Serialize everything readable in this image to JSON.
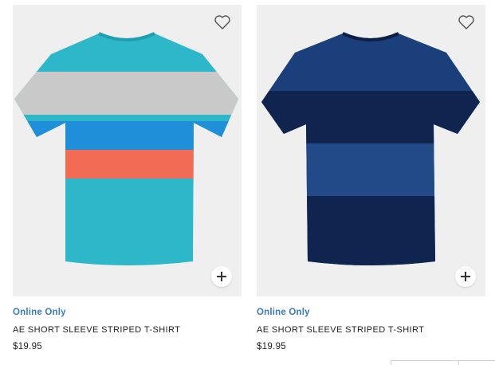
{
  "products": [
    {
      "badge": "Online Only",
      "name": "AE SHORT SLEEVE STRIPED T-SHIRT",
      "price": "$19.95",
      "colors": {
        "base": "#2db7c9",
        "stripe_gray": "#c9c9c9",
        "stripe_blue": "#1e8fd8",
        "stripe_coral": "#f26b55"
      }
    },
    {
      "badge": "Online Only",
      "name": "AE SHORT SLEEVE STRIPED T-SHIRT",
      "price": "$19.95",
      "colors": {
        "base": "#1b3f7a",
        "stripe_dark": "#0f2550",
        "stripe_mid": "#234a88"
      }
    }
  ],
  "icons": {
    "wishlist": "heart-icon",
    "add": "plus-icon"
  },
  "theme": {
    "badge_color": "#3b7bbd",
    "image_bg": "#efefef"
  }
}
